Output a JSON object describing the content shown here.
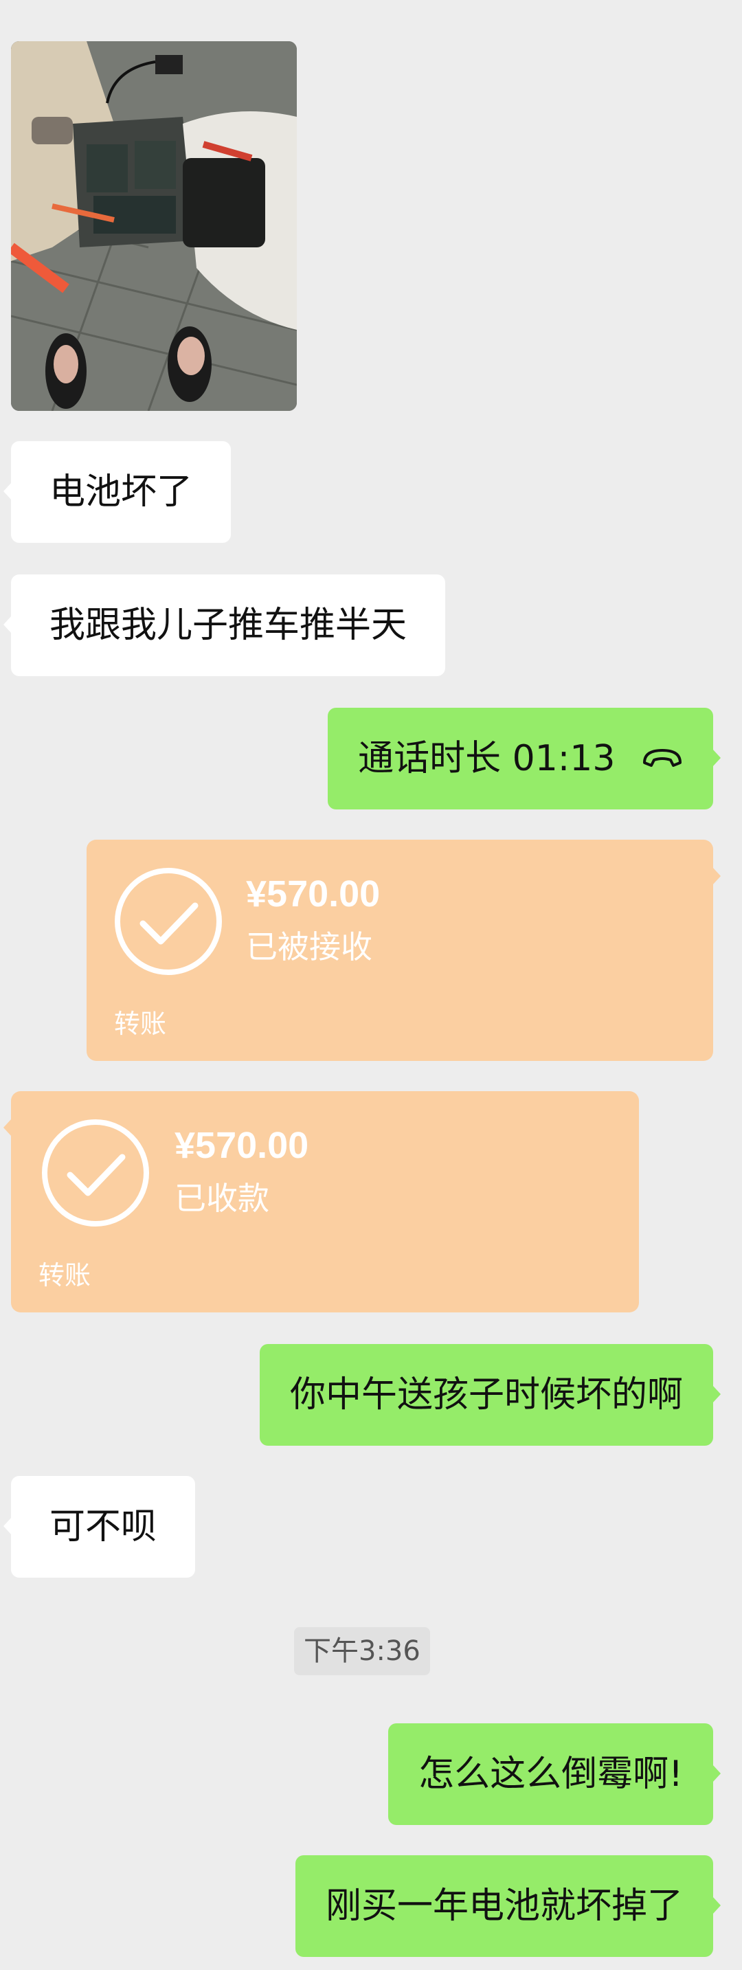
{
  "messages": {
    "m1": "电池坏了",
    "m2": "我跟我儿子推车推半天",
    "call_label": "通话时长 01:13",
    "m3": "你中午送孩子时候坏的啊",
    "m4": "可不呗",
    "m5": "怎么这么倒霉啊!",
    "m6": "刚买一年电池就坏掉了"
  },
  "transfer_sent": {
    "amount": "¥570.00",
    "status": "已被接收",
    "kind": "转账"
  },
  "transfer_received": {
    "amount": "¥570.00",
    "status": "已收款",
    "kind": "转账"
  },
  "timestamp": "下午3:36",
  "colors": {
    "background": "#ededed",
    "bubble_green": "#95ec69",
    "bubble_white": "#ffffff",
    "transfer_orange": "#fbcfa1"
  },
  "icons": {
    "call": "phone-hangup-icon",
    "transfer": "check-circle-icon"
  }
}
